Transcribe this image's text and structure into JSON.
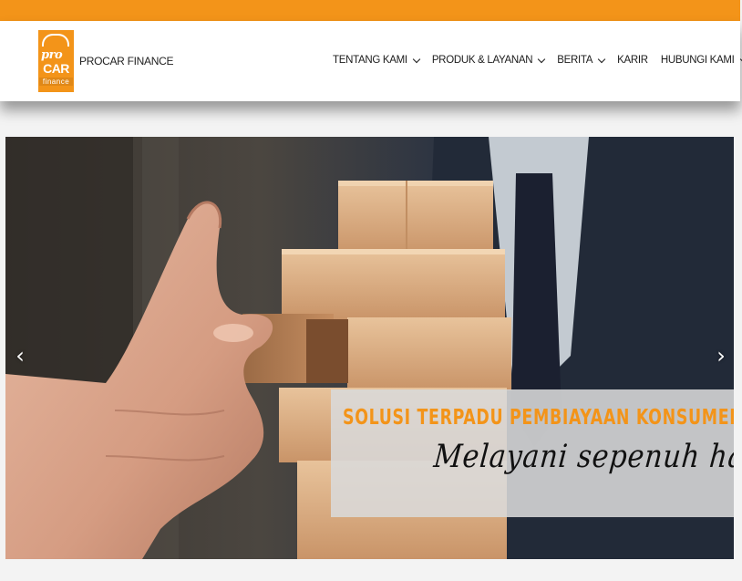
{
  "brand": {
    "name": "PROCAR FINANCE",
    "logo_text": {
      "top": "pro",
      "middle": "CAR",
      "bottom": "finance"
    },
    "color": "#f39419"
  },
  "nav": {
    "items": [
      {
        "label": "TENTANG KAMI",
        "has_dropdown": true
      },
      {
        "label": "PRODUK & LAYANAN",
        "has_dropdown": true
      },
      {
        "label": "BERITA",
        "has_dropdown": true
      },
      {
        "label": "KARIR",
        "has_dropdown": false
      },
      {
        "label": "HUBUNGI KAMI",
        "has_dropdown": true
      }
    ]
  },
  "hero": {
    "headline": "SOLUSI TERPADU PEMBIAYAAN KONSUMEN",
    "tagline": "Melayani sepenuh hati",
    "prev_icon": "‹",
    "next_icon": "›",
    "image": "hand-pulling-wooden-block-from-tower-photo"
  },
  "colors": {
    "accent": "#f39419",
    "header_bg": "#ffffff",
    "caption_bg": "#dadada"
  }
}
